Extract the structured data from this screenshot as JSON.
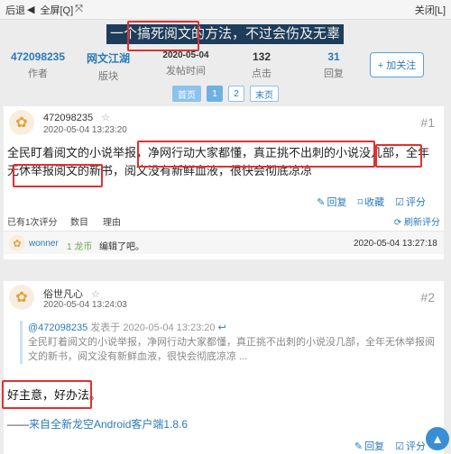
{
  "toolbar": {
    "back_label": "后退",
    "fullscreen_label": "全屏[Q]",
    "close_label": "关闭[L]"
  },
  "thread": {
    "title": "一个搞死阅文的方法，不过会伤及无辜",
    "author_id": "472098235",
    "author_label": "作者",
    "board": "网文江湖",
    "board_label": "版块",
    "post_date": "2020-05-04",
    "post_date_label": "发帖时间",
    "clicks": "132",
    "clicks_label": "点击",
    "replies": "31",
    "replies_label": "回复",
    "follow_label": "+ 加关注"
  },
  "pager": {
    "first": "首页",
    "pages": [
      "1",
      "2"
    ],
    "last": "末页"
  },
  "posts": [
    {
      "user": "472098235",
      "star": "☆",
      "time": "2020-05-04 13:23:20",
      "floor": "#1",
      "body": "全民盯着阅文的小说举报，净网行动大家都懂，真正挑不出刺的小说没几部，全年无休举报阅文的新书，阅文没有新鲜血液，很快会彻底凉凉",
      "actions": [
        "回复",
        "收藏",
        "评分"
      ],
      "rating": {
        "count_label": "已有1次评分",
        "col_num": "数目",
        "col_reason": "理由",
        "refresh_label": "刷新评分",
        "entry": {
          "user": "wonner",
          "amount": "1 龙币",
          "reason": "编辑了吧。",
          "time": "2020-05-04 13:27:18"
        }
      }
    },
    {
      "user": "俗世凡心",
      "star": "☆",
      "time": "2020-05-04 13:24:03",
      "floor": "#2",
      "quote_user": "@472098235",
      "quote_time": "发表于 2020-05-04 13:23:20",
      "quote_body": "全民盯着阅文的小说举报，净网行动大家都懂，真正挑不出刺的小说没几部，全年无休举报阅文的新书，阅文没有新鲜血液，很快会彻底凉凉 ...",
      "body": "好主意，好办法。",
      "signature_prefix": "——",
      "signature": "来自全新龙空Android客户端1.8.6",
      "actions": [
        "回复",
        "评分"
      ]
    }
  ],
  "colors": {
    "accent": "#2a7ab8",
    "title_bg": "#1d3d5a",
    "annotation": "#e03030"
  }
}
